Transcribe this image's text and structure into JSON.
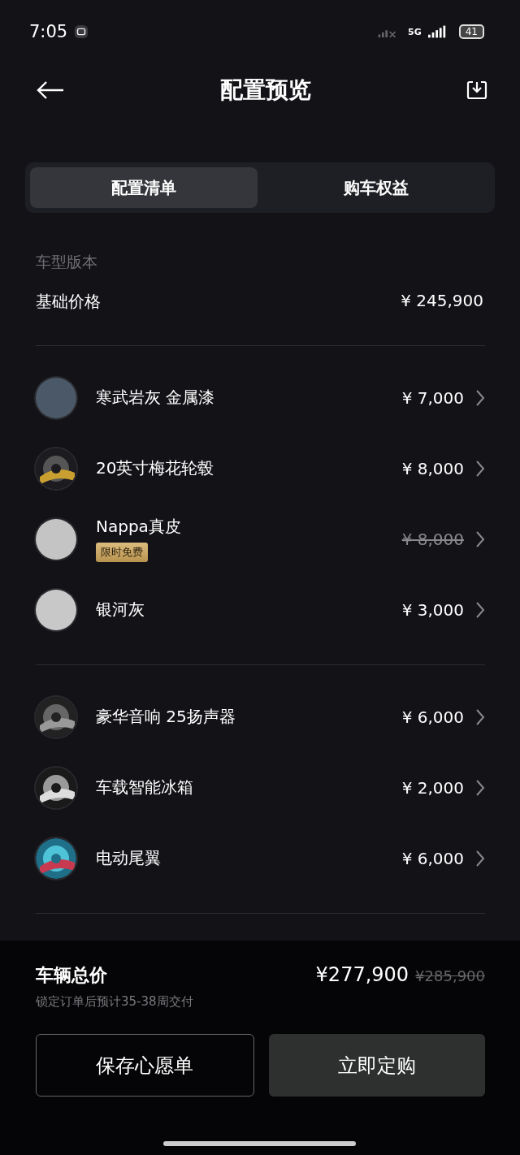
{
  "status_bar": {
    "time": "7:05",
    "network": "5G",
    "battery": "41"
  },
  "header": {
    "title": "配置预览"
  },
  "tabs": [
    {
      "label": "配置清单",
      "selected": true
    },
    {
      "label": "购车权益",
      "selected": false
    }
  ],
  "version": {
    "label": "车型版本",
    "name": "基础价格",
    "price": "¥ 245,900"
  },
  "groups": [
    {
      "items": [
        {
          "kind": "swatch",
          "color": "#4a5868",
          "name": "寒武岩灰 金属漆",
          "price": "¥ 7,000",
          "struck": false
        },
        {
          "kind": "picture",
          "name": "20英寸梅花轮毂",
          "price": "¥ 8,000",
          "struck": false
        },
        {
          "kind": "swatch",
          "color": "#c4c4c4",
          "name": "Nappa真皮",
          "badge": "限时免费",
          "price": "¥ 8,000",
          "struck": true
        },
        {
          "kind": "swatch",
          "color": "#c8c8c8",
          "name": "银河灰",
          "price": "¥ 3,000",
          "struck": false
        }
      ]
    },
    {
      "items": [
        {
          "kind": "picture",
          "name": "豪华音响 25扬声器",
          "price": "¥ 6,000",
          "struck": false
        },
        {
          "kind": "picture",
          "name": "车载智能冰箱",
          "price": "¥ 2,000",
          "struck": false
        },
        {
          "kind": "picture",
          "name": "电动尾翼",
          "price": "¥ 6,000",
          "struck": false
        }
      ]
    }
  ],
  "total": {
    "label": "车辆总价",
    "note": "锁定订单后预计35-38周交付",
    "price": "¥277,900",
    "original_price": "¥285,900"
  },
  "buttons": [
    {
      "label": "保存心愿单",
      "kind": "outline"
    },
    {
      "label": "立即定购",
      "kind": "filled"
    }
  ]
}
